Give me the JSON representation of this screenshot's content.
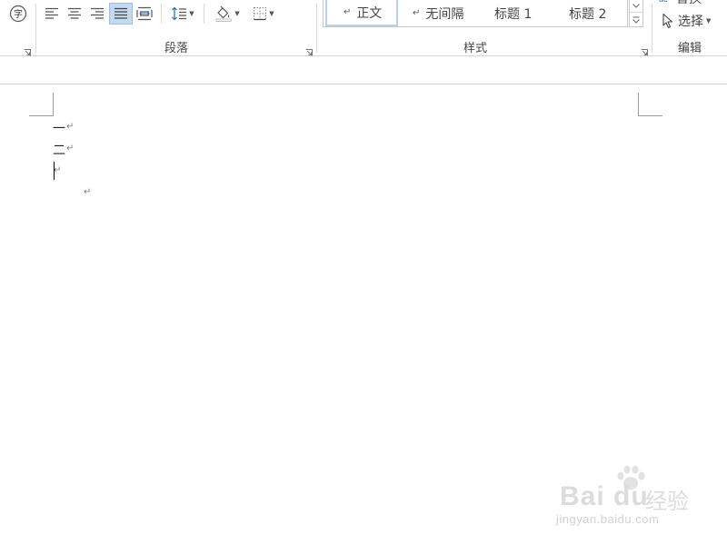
{
  "ribbon": {
    "font_group": {
      "enclose_char_glyph": "字"
    },
    "paragraph_group": {
      "label": "段落"
    },
    "styles_group": {
      "label": "样式",
      "items": [
        {
          "label": "正文",
          "selected": true
        },
        {
          "label": "无间隔",
          "selected": false
        },
        {
          "label": "标题 1",
          "selected": false
        },
        {
          "label": "标题 2",
          "selected": false
        }
      ]
    },
    "editing_group": {
      "label": "编辑",
      "replace_label": "替换",
      "select_label": "选择"
    },
    "colors": {
      "active_bg": "#c5d9f1",
      "active_border": "#9cbde6"
    }
  },
  "document": {
    "lines": [
      {
        "text": "一",
        "mark": "↵"
      },
      {
        "text": "二",
        "mark": "↵"
      },
      {
        "text": "",
        "mark": "↵"
      }
    ],
    "floating_mark": "↵"
  },
  "watermark": {
    "brand": "Bai du",
    "name": "经验",
    "url": "jingyan.baidu.com"
  }
}
